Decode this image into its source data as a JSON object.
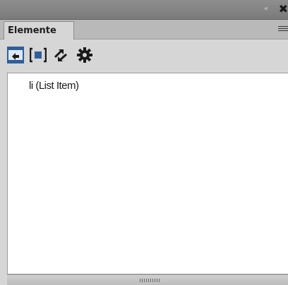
{
  "titlebar": {
    "collapse_icon": "double-chevron-left-icon",
    "close_icon": "close-icon"
  },
  "tabs": [
    {
      "label": "Elemente",
      "active": true
    }
  ],
  "panel_menu_icon": "hamburger-menu-icon",
  "toolbar": {
    "buttons": [
      {
        "icon": "select-parent-icon"
      },
      {
        "icon": "select-child-icon"
      },
      {
        "icon": "swap-arrows-icon"
      },
      {
        "icon": "gear-icon"
      }
    ]
  },
  "elements": [
    {
      "label": "li  (List Item)"
    }
  ],
  "colors": {
    "titlebar": "#7f7f7f",
    "tabstrip": "#b9b9b9",
    "panel": "#d6d6d6",
    "content_bg": "#ffffff",
    "icon_blue": "#2f5f9a"
  }
}
